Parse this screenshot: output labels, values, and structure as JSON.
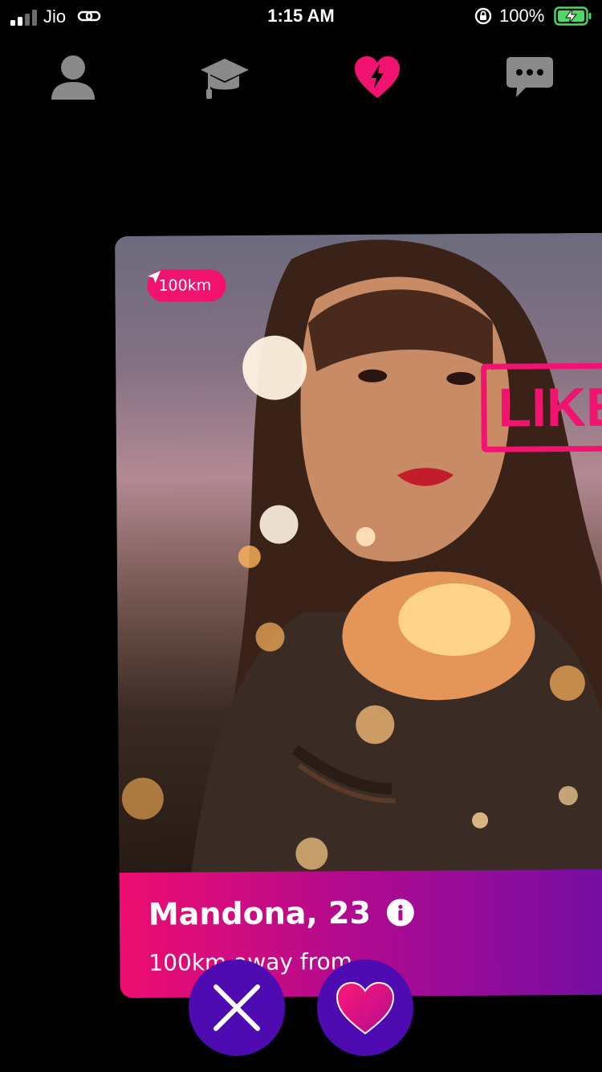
{
  "status_bar": {
    "carrier": "Jio",
    "time": "1:15 AM",
    "battery_percent": "100%",
    "signal_bars_filled": 2,
    "signal_bars_total": 4,
    "icons": [
      "link-icon",
      "rotation-lock-icon",
      "battery-charging-icon"
    ]
  },
  "top_nav": {
    "items": [
      {
        "name": "profile",
        "icon": "person-icon",
        "active": false
      },
      {
        "name": "learn",
        "icon": "graduation-cap-icon",
        "active": false
      },
      {
        "name": "match",
        "icon": "heart-bolt-icon",
        "active": true
      },
      {
        "name": "chat",
        "icon": "chat-bubble-icon",
        "active": false
      }
    ],
    "active_color": "#f1136f",
    "inactive_color": "#8a8a8a"
  },
  "card": {
    "distance": "100km",
    "distance_icon": "navigation-arrow-icon",
    "stamp": "LIKE",
    "name_age": "Mandona, 23",
    "info_icon": "info-icon",
    "subtitle": "100km away from"
  },
  "actions": {
    "dislike_icon": "close-icon",
    "like_icon": "heart-icon"
  },
  "colors": {
    "accent": "#f1136f",
    "button_bg": "#4d0bb1",
    "panel_gradient_start": "#ee0d6f",
    "panel_gradient_end": "#6f0ea5"
  }
}
